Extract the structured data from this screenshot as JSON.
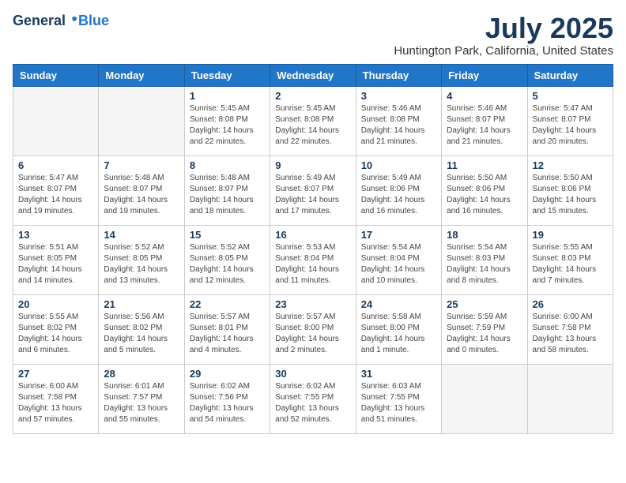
{
  "logo": {
    "general": "General",
    "blue": "Blue"
  },
  "title": {
    "month_year": "July 2025",
    "location": "Huntington Park, California, United States"
  },
  "headers": [
    "Sunday",
    "Monday",
    "Tuesday",
    "Wednesday",
    "Thursday",
    "Friday",
    "Saturday"
  ],
  "weeks": [
    [
      {
        "day": "",
        "info": ""
      },
      {
        "day": "",
        "info": ""
      },
      {
        "day": "1",
        "info": "Sunrise: 5:45 AM\nSunset: 8:08 PM\nDaylight: 14 hours and 22 minutes."
      },
      {
        "day": "2",
        "info": "Sunrise: 5:45 AM\nSunset: 8:08 PM\nDaylight: 14 hours and 22 minutes."
      },
      {
        "day": "3",
        "info": "Sunrise: 5:46 AM\nSunset: 8:08 PM\nDaylight: 14 hours and 21 minutes."
      },
      {
        "day": "4",
        "info": "Sunrise: 5:46 AM\nSunset: 8:07 PM\nDaylight: 14 hours and 21 minutes."
      },
      {
        "day": "5",
        "info": "Sunrise: 5:47 AM\nSunset: 8:07 PM\nDaylight: 14 hours and 20 minutes."
      }
    ],
    [
      {
        "day": "6",
        "info": "Sunrise: 5:47 AM\nSunset: 8:07 PM\nDaylight: 14 hours and 19 minutes."
      },
      {
        "day": "7",
        "info": "Sunrise: 5:48 AM\nSunset: 8:07 PM\nDaylight: 14 hours and 19 minutes."
      },
      {
        "day": "8",
        "info": "Sunrise: 5:48 AM\nSunset: 8:07 PM\nDaylight: 14 hours and 18 minutes."
      },
      {
        "day": "9",
        "info": "Sunrise: 5:49 AM\nSunset: 8:07 PM\nDaylight: 14 hours and 17 minutes."
      },
      {
        "day": "10",
        "info": "Sunrise: 5:49 AM\nSunset: 8:06 PM\nDaylight: 14 hours and 16 minutes."
      },
      {
        "day": "11",
        "info": "Sunrise: 5:50 AM\nSunset: 8:06 PM\nDaylight: 14 hours and 16 minutes."
      },
      {
        "day": "12",
        "info": "Sunrise: 5:50 AM\nSunset: 8:06 PM\nDaylight: 14 hours and 15 minutes."
      }
    ],
    [
      {
        "day": "13",
        "info": "Sunrise: 5:51 AM\nSunset: 8:05 PM\nDaylight: 14 hours and 14 minutes."
      },
      {
        "day": "14",
        "info": "Sunrise: 5:52 AM\nSunset: 8:05 PM\nDaylight: 14 hours and 13 minutes."
      },
      {
        "day": "15",
        "info": "Sunrise: 5:52 AM\nSunset: 8:05 PM\nDaylight: 14 hours and 12 minutes."
      },
      {
        "day": "16",
        "info": "Sunrise: 5:53 AM\nSunset: 8:04 PM\nDaylight: 14 hours and 11 minutes."
      },
      {
        "day": "17",
        "info": "Sunrise: 5:54 AM\nSunset: 8:04 PM\nDaylight: 14 hours and 10 minutes."
      },
      {
        "day": "18",
        "info": "Sunrise: 5:54 AM\nSunset: 8:03 PM\nDaylight: 14 hours and 8 minutes."
      },
      {
        "day": "19",
        "info": "Sunrise: 5:55 AM\nSunset: 8:03 PM\nDaylight: 14 hours and 7 minutes."
      }
    ],
    [
      {
        "day": "20",
        "info": "Sunrise: 5:55 AM\nSunset: 8:02 PM\nDaylight: 14 hours and 6 minutes."
      },
      {
        "day": "21",
        "info": "Sunrise: 5:56 AM\nSunset: 8:02 PM\nDaylight: 14 hours and 5 minutes."
      },
      {
        "day": "22",
        "info": "Sunrise: 5:57 AM\nSunset: 8:01 PM\nDaylight: 14 hours and 4 minutes."
      },
      {
        "day": "23",
        "info": "Sunrise: 5:57 AM\nSunset: 8:00 PM\nDaylight: 14 hours and 2 minutes."
      },
      {
        "day": "24",
        "info": "Sunrise: 5:58 AM\nSunset: 8:00 PM\nDaylight: 14 hours and 1 minute."
      },
      {
        "day": "25",
        "info": "Sunrise: 5:59 AM\nSunset: 7:59 PM\nDaylight: 14 hours and 0 minutes."
      },
      {
        "day": "26",
        "info": "Sunrise: 6:00 AM\nSunset: 7:58 PM\nDaylight: 13 hours and 58 minutes."
      }
    ],
    [
      {
        "day": "27",
        "info": "Sunrise: 6:00 AM\nSunset: 7:58 PM\nDaylight: 13 hours and 57 minutes."
      },
      {
        "day": "28",
        "info": "Sunrise: 6:01 AM\nSunset: 7:57 PM\nDaylight: 13 hours and 55 minutes."
      },
      {
        "day": "29",
        "info": "Sunrise: 6:02 AM\nSunset: 7:56 PM\nDaylight: 13 hours and 54 minutes."
      },
      {
        "day": "30",
        "info": "Sunrise: 6:02 AM\nSunset: 7:55 PM\nDaylight: 13 hours and 52 minutes."
      },
      {
        "day": "31",
        "info": "Sunrise: 6:03 AM\nSunset: 7:55 PM\nDaylight: 13 hours and 51 minutes."
      },
      {
        "day": "",
        "info": ""
      },
      {
        "day": "",
        "info": ""
      }
    ]
  ]
}
